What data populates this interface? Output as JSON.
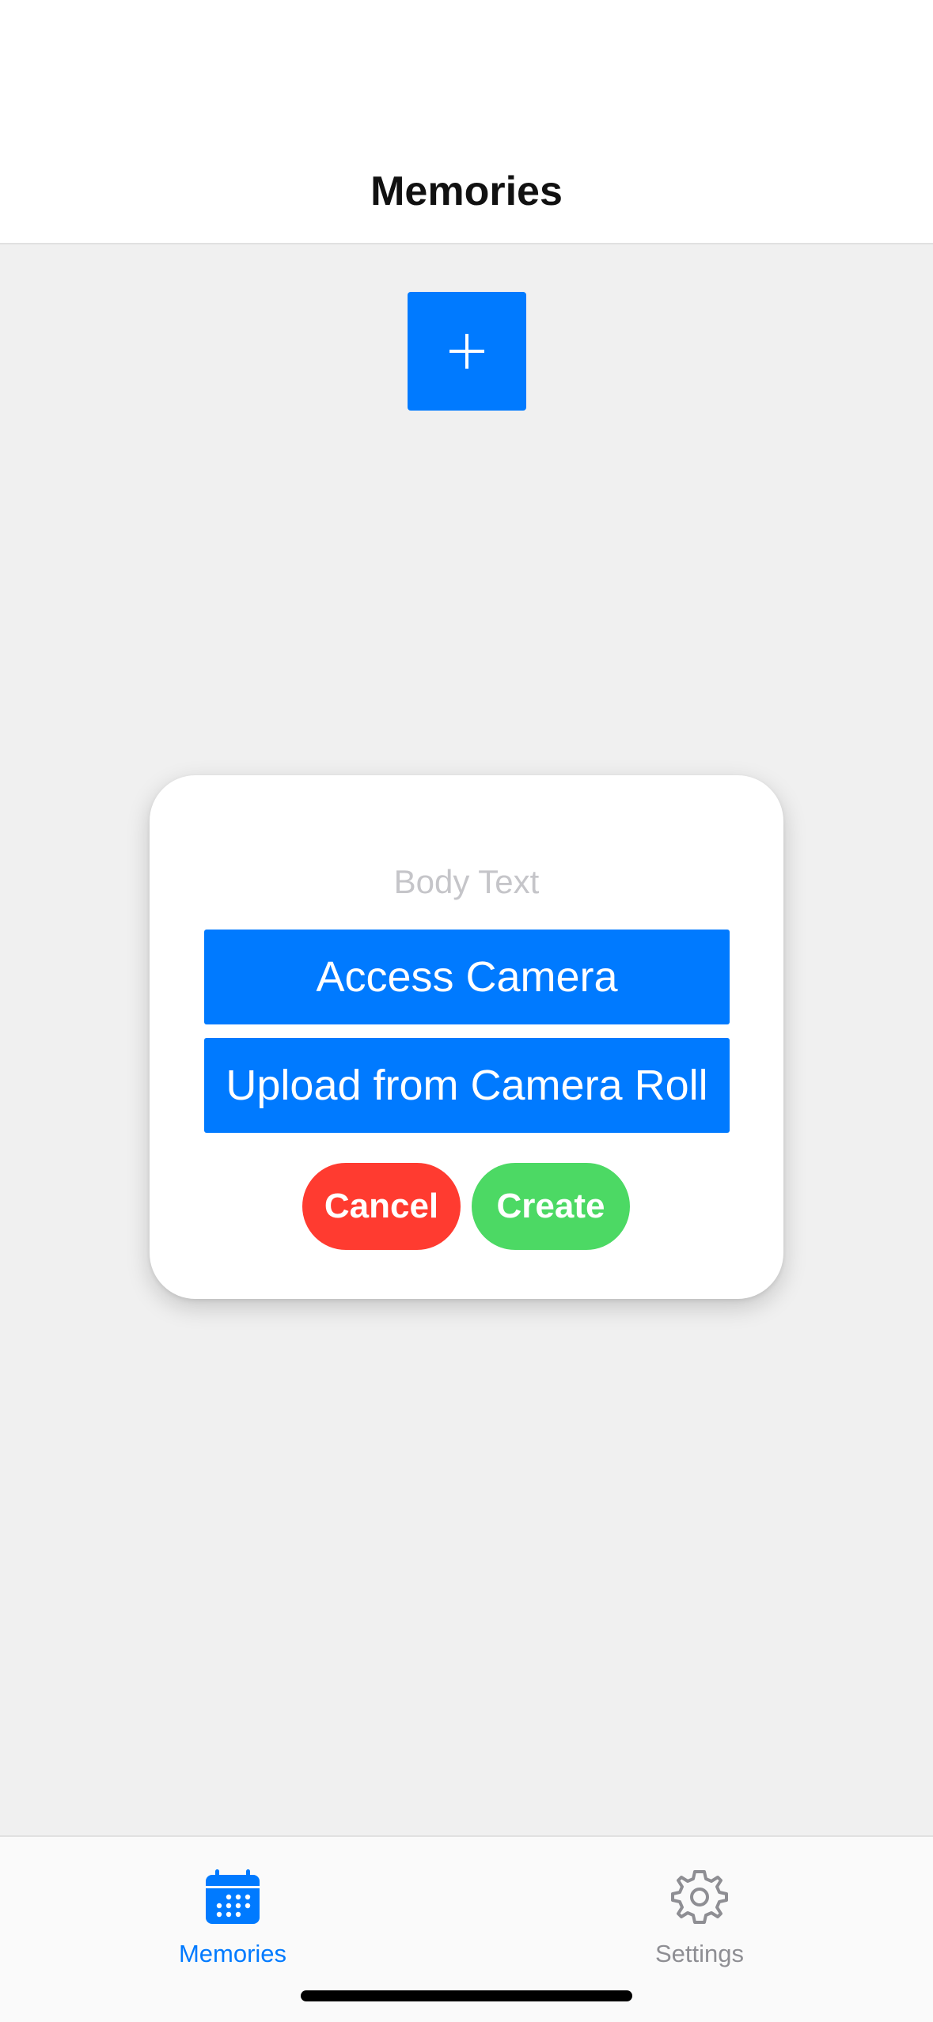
{
  "nav": {
    "title": "Memories"
  },
  "add_button": {
    "icon": "plus-icon"
  },
  "modal": {
    "body_text": "Body Text",
    "access_camera_label": "Access Camera",
    "upload_label": "Upload from Camera Roll",
    "cancel_label": "Cancel",
    "create_label": "Create"
  },
  "tabs": [
    {
      "label": "Memories",
      "icon": "calendar-icon",
      "active": true
    },
    {
      "label": "Settings",
      "icon": "gear-icon",
      "active": false
    }
  ],
  "colors": {
    "accent": "#007aff",
    "cancel": "#ff3b30",
    "create": "#4cd964",
    "inactive": "#8e8e93",
    "background": "#f0f0f0"
  }
}
